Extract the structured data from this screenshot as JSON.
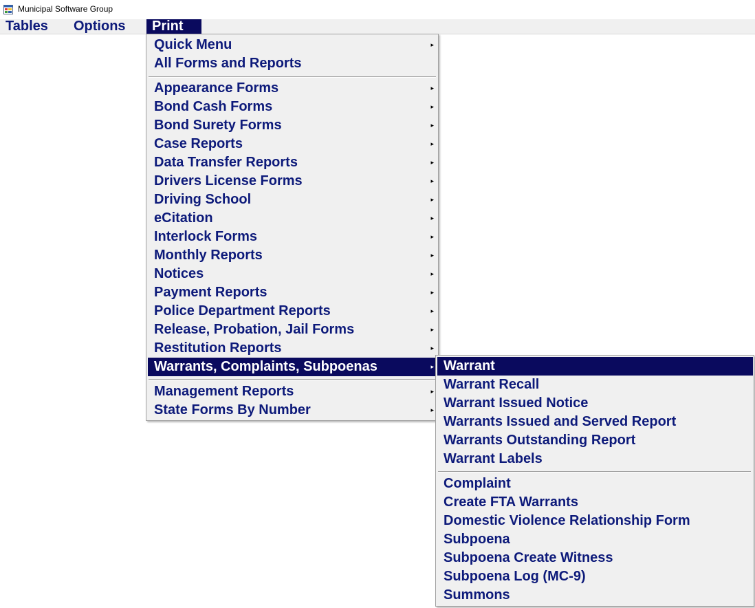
{
  "window": {
    "title": "Municipal Software Group",
    "icon": "app-window-icon"
  },
  "menubar": {
    "items": [
      {
        "label": "Tables"
      },
      {
        "label": "Options"
      },
      {
        "label": "Print",
        "active": true
      }
    ]
  },
  "print_menu": {
    "items": [
      {
        "label": "Quick Menu",
        "submenu": true
      },
      {
        "label": "All Forms and Reports",
        "submenu": false
      },
      {
        "label": "Appearance Forms",
        "submenu": true
      },
      {
        "label": "Bond Cash Forms",
        "submenu": true
      },
      {
        "label": "Bond Surety Forms",
        "submenu": true
      },
      {
        "label": "Case Reports",
        "submenu": true
      },
      {
        "label": "Data Transfer Reports",
        "submenu": true
      },
      {
        "label": "Drivers License Forms",
        "submenu": true
      },
      {
        "label": "Driving School",
        "submenu": true
      },
      {
        "label": "eCitation",
        "submenu": true
      },
      {
        "label": "Interlock Forms",
        "submenu": true
      },
      {
        "label": "Monthly Reports",
        "submenu": true
      },
      {
        "label": "Notices",
        "submenu": true
      },
      {
        "label": "Payment Reports",
        "submenu": true
      },
      {
        "label": "Police Department Reports",
        "submenu": true
      },
      {
        "label": "Release, Probation, Jail Forms",
        "submenu": true
      },
      {
        "label": "Restitution Reports",
        "submenu": true
      },
      {
        "label": "Warrants, Complaints, Subpoenas",
        "submenu": true,
        "selected": true
      },
      {
        "label": "Management Reports",
        "submenu": true
      },
      {
        "label": "State Forms By Number",
        "submenu": true
      }
    ]
  },
  "warrants_submenu": {
    "items": [
      {
        "label": "Warrant",
        "selected": true
      },
      {
        "label": "Warrant Recall"
      },
      {
        "label": "Warrant Issued Notice"
      },
      {
        "label": "Warrants Issued and Served Report"
      },
      {
        "label": "Warrants Outstanding Report"
      },
      {
        "label": "Warrant Labels"
      },
      {
        "label": "Complaint"
      },
      {
        "label": "Create FTA Warrants"
      },
      {
        "label": "Domestic Violence Relationship Form"
      },
      {
        "label": "Subpoena"
      },
      {
        "label": "Subpoena Create Witness"
      },
      {
        "label": "Subpoena Log (MC-9)"
      },
      {
        "label": "Summons"
      }
    ]
  },
  "icons": {
    "submenu_arrow": "submenu-arrow-icon"
  },
  "colors": {
    "menu_text": "#0d1a7a",
    "highlight_bg": "#0a0a5e",
    "menu_bg": "#f0f0f0"
  }
}
